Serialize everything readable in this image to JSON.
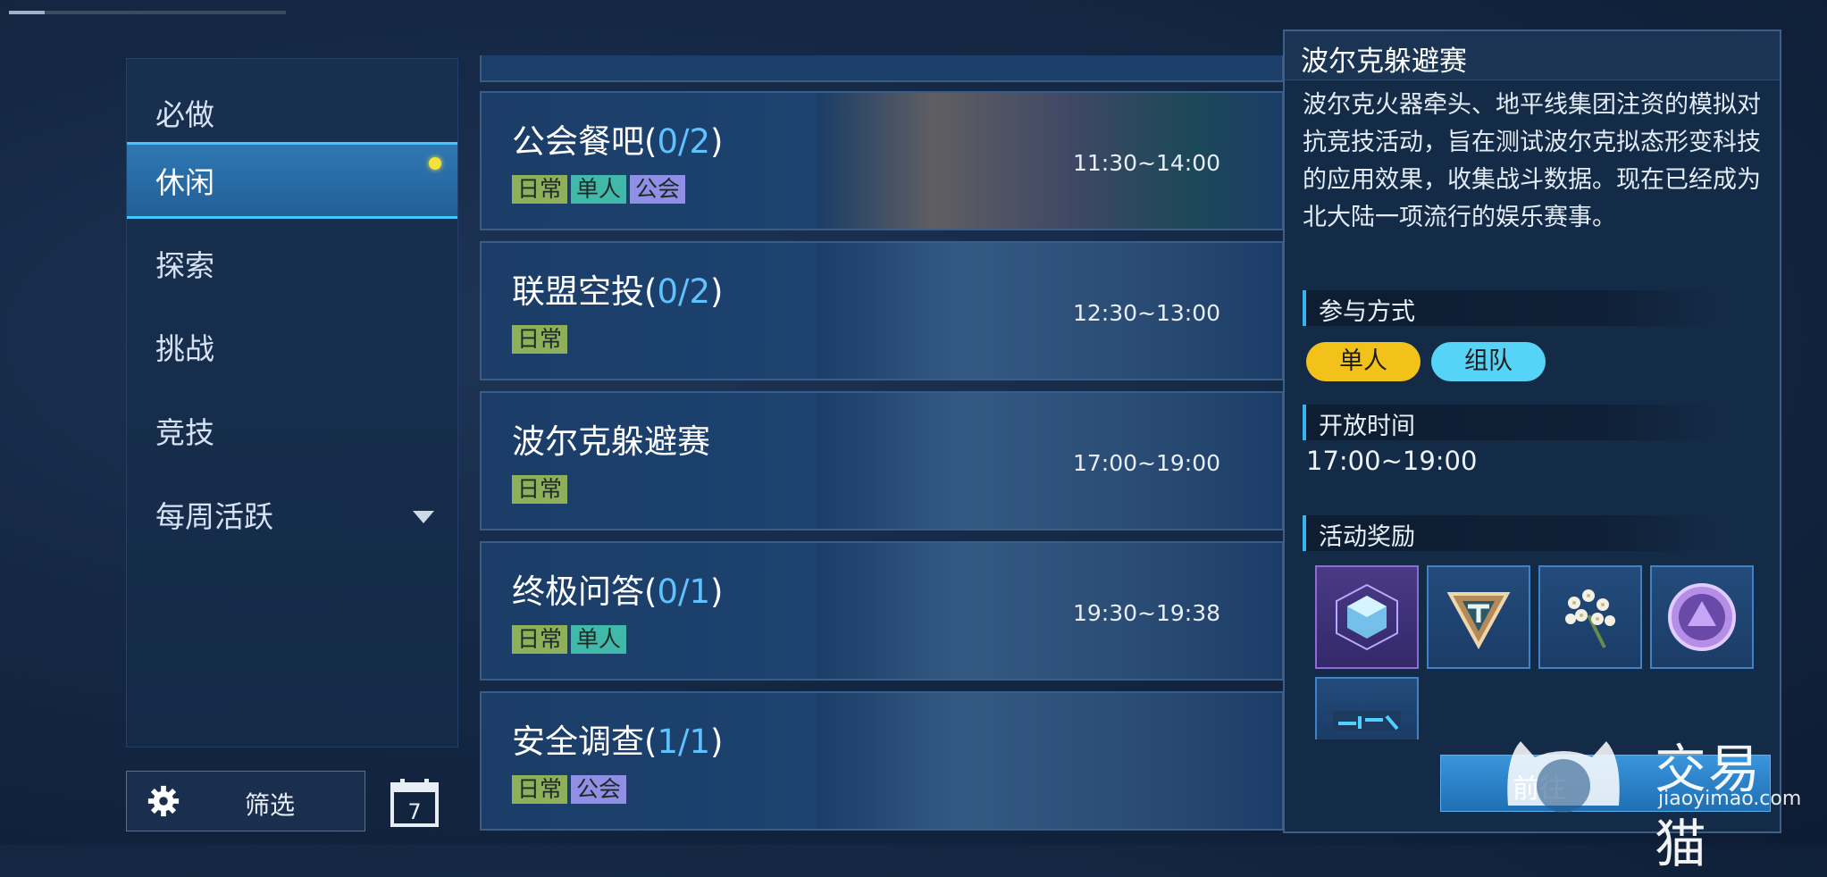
{
  "sidebar": {
    "items": [
      {
        "label": "必做"
      },
      {
        "label": "休闲"
      },
      {
        "label": "探索"
      },
      {
        "label": "挑战"
      },
      {
        "label": "竞技"
      },
      {
        "label": "每周活跃"
      }
    ],
    "active_index": 1,
    "filter_label": "筛选",
    "calendar_day": "7"
  },
  "activities": [
    {
      "name": "公会餐吧",
      "count": "0/2",
      "time": "11:30~14:00",
      "tags": [
        "日常",
        "单人",
        "公会"
      ]
    },
    {
      "name": "联盟空投",
      "count": "0/2",
      "time": "12:30~13:00",
      "tags": [
        "日常"
      ]
    },
    {
      "name": "波尔克躲避赛",
      "count": "",
      "time": "17:00~19:00",
      "tags": [
        "日常"
      ]
    },
    {
      "name": "终极问答",
      "count": "0/1",
      "time": "19:30~19:38",
      "tags": [
        "日常",
        "单人"
      ]
    },
    {
      "name": "安全调查",
      "count": "1/1",
      "time": "",
      "tags": [
        "日常",
        "公会"
      ]
    }
  ],
  "detail": {
    "title": "波尔克躲避赛",
    "description": "波尔克火器牵头、地平线集团注资的模拟对抗竞技活动，旨在测试波尔克拟态形变科技的应用效果，收集战斗数据。现在已经成为北大陆一项流行的娱乐赛事。",
    "mode_heading": "参与方式",
    "modes": [
      "单人",
      "组队"
    ],
    "time_heading": "开放时间",
    "open_time": "17:00~19:00",
    "reward_heading": "活动奖励",
    "rewards": [
      "cube-crystal-icon",
      "triangle-badge-icon",
      "flower-bouquet-icon",
      "purple-coin-icon",
      "title-card-icon"
    ],
    "goto_label": "前往"
  },
  "watermark": {
    "cn": "交易猫",
    "en": "jiaoyimao.com"
  },
  "colors": {
    "accent": "#3fc7ff",
    "tag_daily": "#8fb05b",
    "tag_solo": "#41b8aa",
    "tag_guild": "#8f8fe6",
    "pill_solo": "#f2c21b",
    "pill_team": "#55d4f7"
  }
}
